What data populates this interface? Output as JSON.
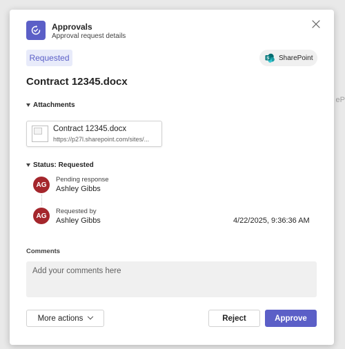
{
  "background": {
    "peek_text": "eP"
  },
  "header": {
    "app_title": "Approvals",
    "app_subtitle": "Approval request details",
    "icon": "approvals-icon",
    "close_icon": "close-icon"
  },
  "request": {
    "status_tag": "Requested",
    "source_chip": "SharePoint",
    "source_icon": "sharepoint-icon",
    "title": "Contract 12345.docx"
  },
  "attachments": {
    "header": "Attachments",
    "items": [
      {
        "name": "Contract 12345.docx",
        "url": "https://p27l.sharepoint.com/sites/..."
      }
    ]
  },
  "status": {
    "header": "Status: Requested",
    "steps": [
      {
        "initials": "AG",
        "label": "Pending response",
        "name": "Ashley Gibbs",
        "timestamp": ""
      },
      {
        "initials": "AG",
        "label": "Requested by",
        "name": "Ashley Gibbs",
        "timestamp": "4/22/2025, 9:36:36 AM"
      }
    ]
  },
  "comments": {
    "label": "Comments",
    "placeholder": "Add your comments here",
    "value": ""
  },
  "actions": {
    "more_label": "More actions",
    "reject_label": "Reject",
    "approve_label": "Approve"
  },
  "colors": {
    "accent": "#5b5fc7",
    "avatar": "#a4262c",
    "status_tag_bg": "#e8ebfa"
  }
}
